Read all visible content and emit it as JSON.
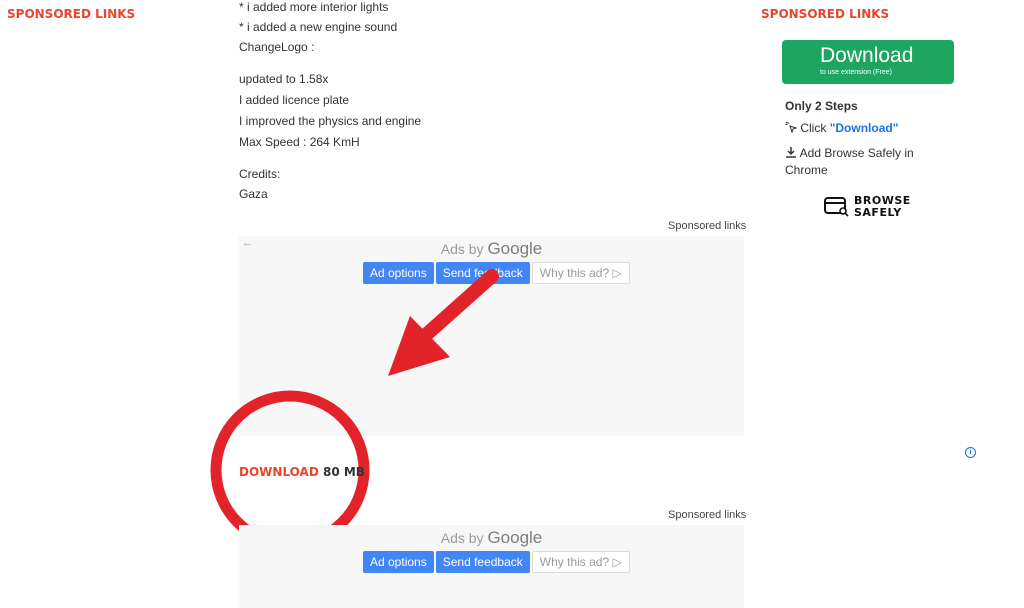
{
  "left_sidebar": {
    "sponsored_heading": "SPONSORED LINKS"
  },
  "article": {
    "lines": [
      "* i added more interior lights",
      "* i added a new engine sound",
      "ChangeLogo :",
      "updated to 1.58x",
      "I added licence plate",
      "I improved the physics and engine",
      "Max Speed : 264 KmH",
      "Credits:",
      "Gaza"
    ]
  },
  "ad_top": {
    "sponsored_label": "Sponsored links",
    "ads_by_prefix": "Ads by",
    "ads_by_brand": "Google",
    "back_glyph": "←",
    "ad_options": "Ad options",
    "send_feedback": "Send feedback",
    "why_this_ad": "Why this ad?",
    "why_icon": "play-triangle-icon"
  },
  "download": {
    "label": "DOWNLOAD",
    "size": "80 MB",
    "annotation_color": "#e3232a"
  },
  "ad_bottom": {
    "sponsored_label": "Sponsored links",
    "ads_by_prefix": "Ads by",
    "ads_by_brand": "Google",
    "ad_options": "Ad options",
    "send_feedback": "Send feedback",
    "why_this_ad": "Why this ad?"
  },
  "right_sidebar": {
    "sponsored_heading": "SPONSORED LINKS",
    "download_cta": {
      "title": "Download",
      "subtitle": "to use extension (Free)",
      "color": "#1ea660"
    },
    "steps_title": "Only 2 Steps",
    "step1_prefix": "Click",
    "step1_link": "\"Download\"",
    "step2": "Add Browse Safely in Chrome",
    "brand_line1": "BROWSE",
    "brand_line2": "SAFELY",
    "info_glyph": "i"
  },
  "colors": {
    "accent_red": "#e8452c",
    "google_blue": "#4285f4",
    "link_blue": "#1a73e8"
  }
}
